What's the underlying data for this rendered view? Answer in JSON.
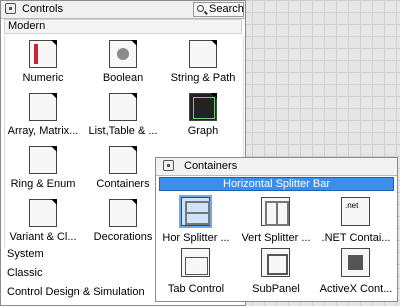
{
  "palette": {
    "title": "Controls",
    "search_label": "Search",
    "section": "Modern",
    "items": [
      {
        "label": "Numeric",
        "icon": "numeric-control-icon"
      },
      {
        "label": "Boolean",
        "icon": "boolean-control-icon"
      },
      {
        "label": "String & Path",
        "icon": "string-path-icon"
      },
      {
        "label": "Array, Matrix...",
        "icon": "array-matrix-icon"
      },
      {
        "label": "List,Table & ...",
        "icon": "list-table-icon"
      },
      {
        "label": "Graph",
        "icon": "graph-icon"
      },
      {
        "label": "Ring & Enum",
        "icon": "ring-enum-icon"
      },
      {
        "label": "Containers",
        "icon": "containers-icon"
      },
      {
        "label": "",
        "icon": ""
      },
      {
        "label": "Variant & Cl...",
        "icon": "variant-class-icon"
      },
      {
        "label": "Decorations",
        "icon": "decorations-icon"
      }
    ],
    "categories": [
      "System",
      "Classic",
      "Control Design & Simulation"
    ]
  },
  "submenu": {
    "title": "Containers",
    "tooltip": "Horizontal Splitter Bar",
    "items": [
      {
        "label": "Hor Splitter ...",
        "icon": "horizontal-splitter-icon",
        "selected": true
      },
      {
        "label": "Vert Splitter ...",
        "icon": "vertical-splitter-icon",
        "selected": false
      },
      {
        "label": ".NET Contai...",
        "icon": "dotnet-container-icon",
        "selected": false
      },
      {
        "label": "Tab Control",
        "icon": "tab-control-icon",
        "selected": false
      },
      {
        "label": "SubPanel",
        "icon": "subpanel-icon",
        "selected": false
      },
      {
        "label": "ActiveX Cont...",
        "icon": "activex-container-icon",
        "selected": false
      }
    ]
  }
}
